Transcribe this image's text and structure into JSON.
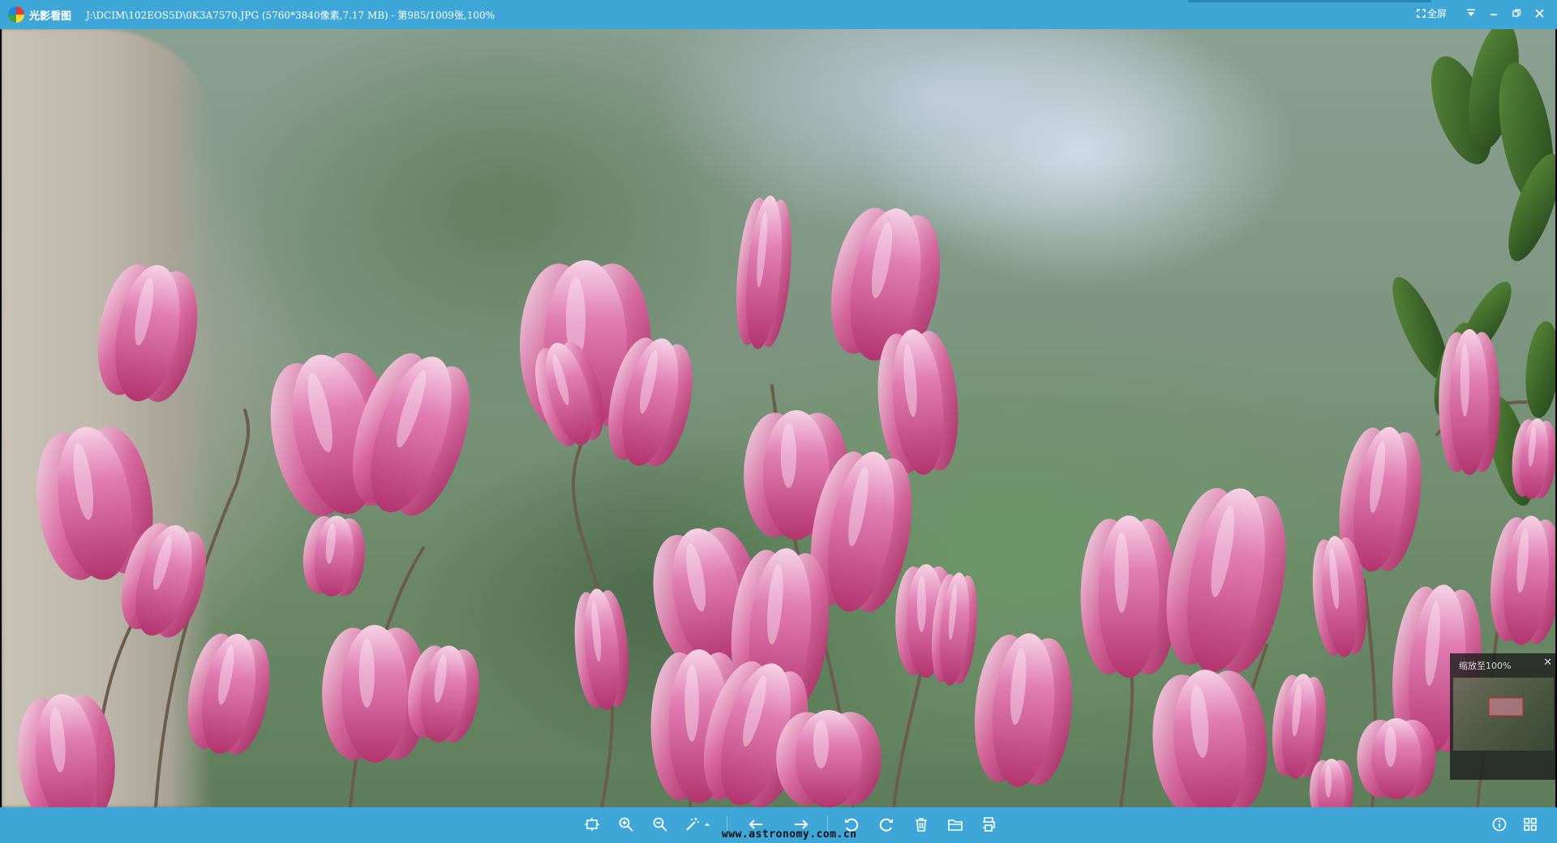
{
  "titlebar": {
    "app_name": "光影看图",
    "file_info": "J:\\DCIM\\102EOS5D\\0K3A7570.JPG (5760*3840像素,7.17 MB) - 第985/1009张,100%",
    "fullscreen_label": "全屏"
  },
  "navigator": {
    "title": "缩放至100%"
  },
  "toolbar": {
    "buttons": [
      "fit-window",
      "zoom-in",
      "zoom-out",
      "auto-enhance",
      "previous",
      "next",
      "rotate-left",
      "rotate-right",
      "delete",
      "open-folder",
      "print",
      "info",
      "grid-view"
    ]
  },
  "watermark": "www.astronomy.com.cn",
  "colors": {
    "titlebar": "#3fa7d8",
    "toolbar": "#3fa7d8",
    "icon": "#ffffff"
  }
}
